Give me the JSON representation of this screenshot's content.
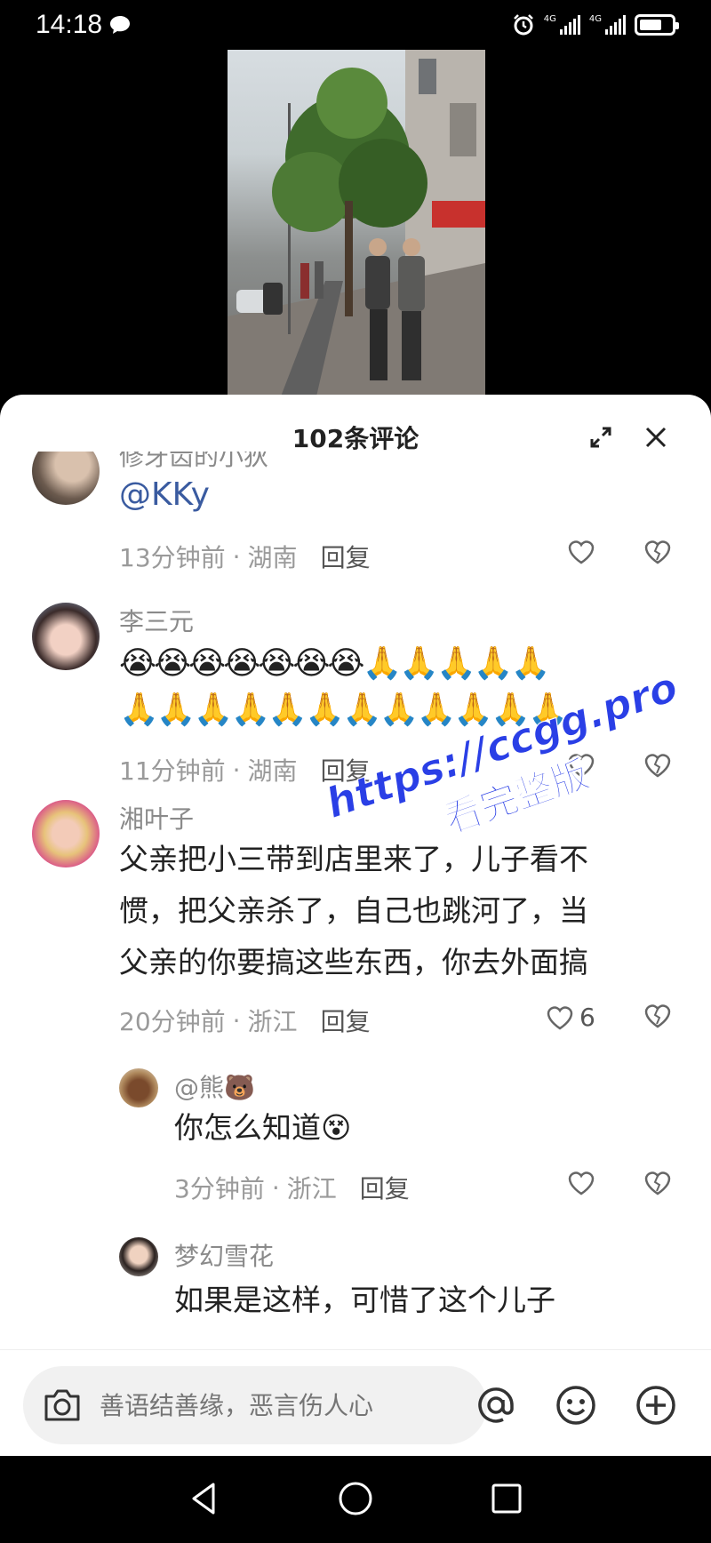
{
  "status": {
    "time": "14:18",
    "net1": "4G",
    "net2": "4G"
  },
  "sheet": {
    "title": "102条评论"
  },
  "comments": [
    {
      "name": "修牙齿的小狄",
      "text": "@KKy",
      "time": "13分钟前",
      "region": "湖南",
      "reply": "回复",
      "likes": ""
    },
    {
      "name": "李三元",
      "line1": "😭😭😭😭😭😭😭🙏🙏🙏🙏🙏",
      "line2": "🙏🙏🙏🙏🙏🙏🙏🙏🙏🙏🙏🙏",
      "time": "11分钟前",
      "region": "湖南",
      "reply": "回复",
      "likes": ""
    },
    {
      "name": "湘叶子",
      "line1": "父亲把小三带到店里来了，儿子看不",
      "line2": "惯，把父亲杀了，自己也跳河了，当",
      "line3": "父亲的你要搞这些东西，你去外面搞",
      "time": "20分钟前",
      "region": "浙江",
      "reply": "回复",
      "likes": "6"
    },
    {
      "name": "@熊🐻",
      "text": "你怎么知道😵",
      "time": "3分钟前",
      "region": "浙江",
      "reply": "回复",
      "likes": ""
    },
    {
      "name": "梦幻雪花",
      "text": "如果是这样，可惜了这个儿子"
    }
  ],
  "separator": "·",
  "input": {
    "placeholder": "善语结善缘，恶言伤人心"
  },
  "watermark": {
    "url": "https://ccgg.pro",
    "caption": "看完整版"
  }
}
